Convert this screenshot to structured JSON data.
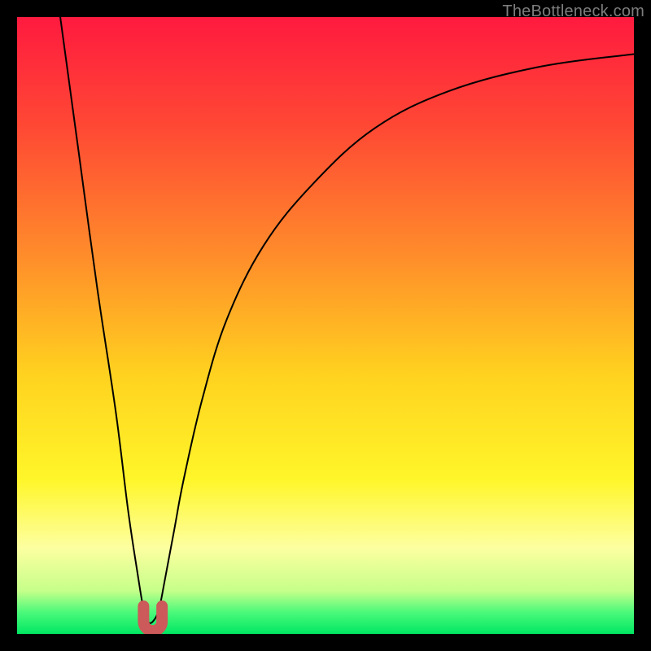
{
  "watermark": "TheBottleneck.com",
  "chart_data": {
    "type": "line",
    "title": "",
    "xlabel": "",
    "ylabel": "",
    "xlim": [
      0,
      100
    ],
    "ylim": [
      0,
      100
    ],
    "grid": false,
    "background": {
      "type": "vertical-gradient",
      "stops": [
        {
          "pos": 0.0,
          "color": "#ff1a3f"
        },
        {
          "pos": 0.18,
          "color": "#ff4934"
        },
        {
          "pos": 0.38,
          "color": "#ff8a2b"
        },
        {
          "pos": 0.58,
          "color": "#ffd21f"
        },
        {
          "pos": 0.75,
          "color": "#fff62a"
        },
        {
          "pos": 0.86,
          "color": "#fdffa0"
        },
        {
          "pos": 0.93,
          "color": "#c6ff8a"
        },
        {
          "pos": 0.965,
          "color": "#4bf97a"
        },
        {
          "pos": 1.0,
          "color": "#00e763"
        }
      ]
    },
    "series": [
      {
        "name": "bottleneck-curve",
        "stroke": "#000000",
        "stroke_width": 2,
        "x": [
          7,
          10,
          13,
          16,
          18,
          19.5,
          20.5,
          21.2,
          22,
          23,
          24,
          25.5,
          27,
          30,
          34,
          40,
          48,
          58,
          70,
          85,
          100
        ],
        "y": [
          100,
          78,
          56,
          36,
          20,
          10,
          4,
          2,
          2,
          4,
          9,
          17,
          25,
          38,
          51,
          63,
          73,
          82,
          88,
          92,
          94
        ]
      }
    ],
    "marker": {
      "name": "min-marker",
      "shape": "u",
      "color": "#cc5a5a",
      "x_range": [
        20.5,
        23.5
      ],
      "y_range": [
        0.5,
        4.5
      ],
      "stroke_width": 14
    }
  }
}
